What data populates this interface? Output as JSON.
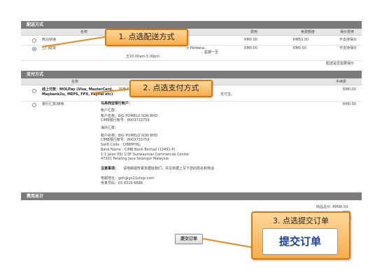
{
  "shipping": {
    "section_title": "配送方式",
    "col_name": "名称",
    "col_fee": "费用",
    "col_free": "免费额度",
    "col_insure": "保价费用",
    "rows": [
      {
        "name": "西马快递",
        "fee": "RM0.00",
        "free": "RM50.00",
        "insure": "不支持保价",
        "selected": false
      },
      {
        "name": "上门取货",
        "desc1": "n Perdana,",
        "desc2": "：星期一至",
        "desc3": "五10.00am-5.00pm",
        "fee": "RM0.00",
        "free": "RM0.00",
        "insure": "不支持保价",
        "selected": true
      }
    ],
    "insure_note": "配送是否需要保价"
  },
  "payment": {
    "section_title": "支付方式",
    "col_name": "名称",
    "col_fee": "手续费",
    "rows": [
      {
        "name": "线上付款：MOLPay (Visa, MasterCard, Maybank2u, MEPS, FPX, PayPal etc)",
        "name_l1": "线上付款：MOLPay (Visa, MasterCard,",
        "name_l2": "Maybank2u, MEPS, FPX, PayPal etc)",
        "desc": "信用卡（Visa",
        "desc_tail": "支付宝。",
        "fee": "RM0.00"
      },
      {
        "name": "银行汇款/转帐",
        "fee": "RM0.00"
      }
    ],
    "bank_info": {
      "heading": "马来西亚银行帐户：",
      "account_label": "帐户汇款：",
      "name1": "帐户名称：BIG POMELO SDN BHD",
      "acct1": "CIMB银行帐号：8003733759",
      "overseas_label": "海外汇款：",
      "name2": "帐户名称：BIG POMELO SDN BHD",
      "acct2": "CIMB银行帐号：8003733759",
      "swift": "Swift Code : CIBBMYKL",
      "bank_name": "Bank Name : CIMB Bank Berhad (13491-P)",
      "addr1": "1-1 Jalan PJU 1/3F Sunwaymas Commercial Centre",
      "addr2": "47301 Petaling Jaya Selangor Malaysia",
      "note_label": "注意事项：",
      "note": "请电邮或传真单据给我们，并在单据上写下您的姓名和电话",
      "email": "电邮地址：goh@go11shop.com",
      "fax": "传真号码：03 8319 6688"
    }
  },
  "totals": {
    "section_title": "费用总计",
    "goods_total": "商品总价: RM90.50",
    "line2": "RM0.",
    "line3": "RM"
  },
  "submit": {
    "small_label": "提交订单",
    "big_label": "提交订单"
  },
  "callouts": {
    "step1": "1. 点选配送方式",
    "step2": "2. 点选支付方式",
    "step3": "3. 点选提交订单"
  },
  "colors": {
    "section_bar": "#7b7b7b",
    "callout_fill": "#f8ad4a",
    "callout_border": "#d07a12",
    "radio_selected": "#1a6fd6"
  }
}
